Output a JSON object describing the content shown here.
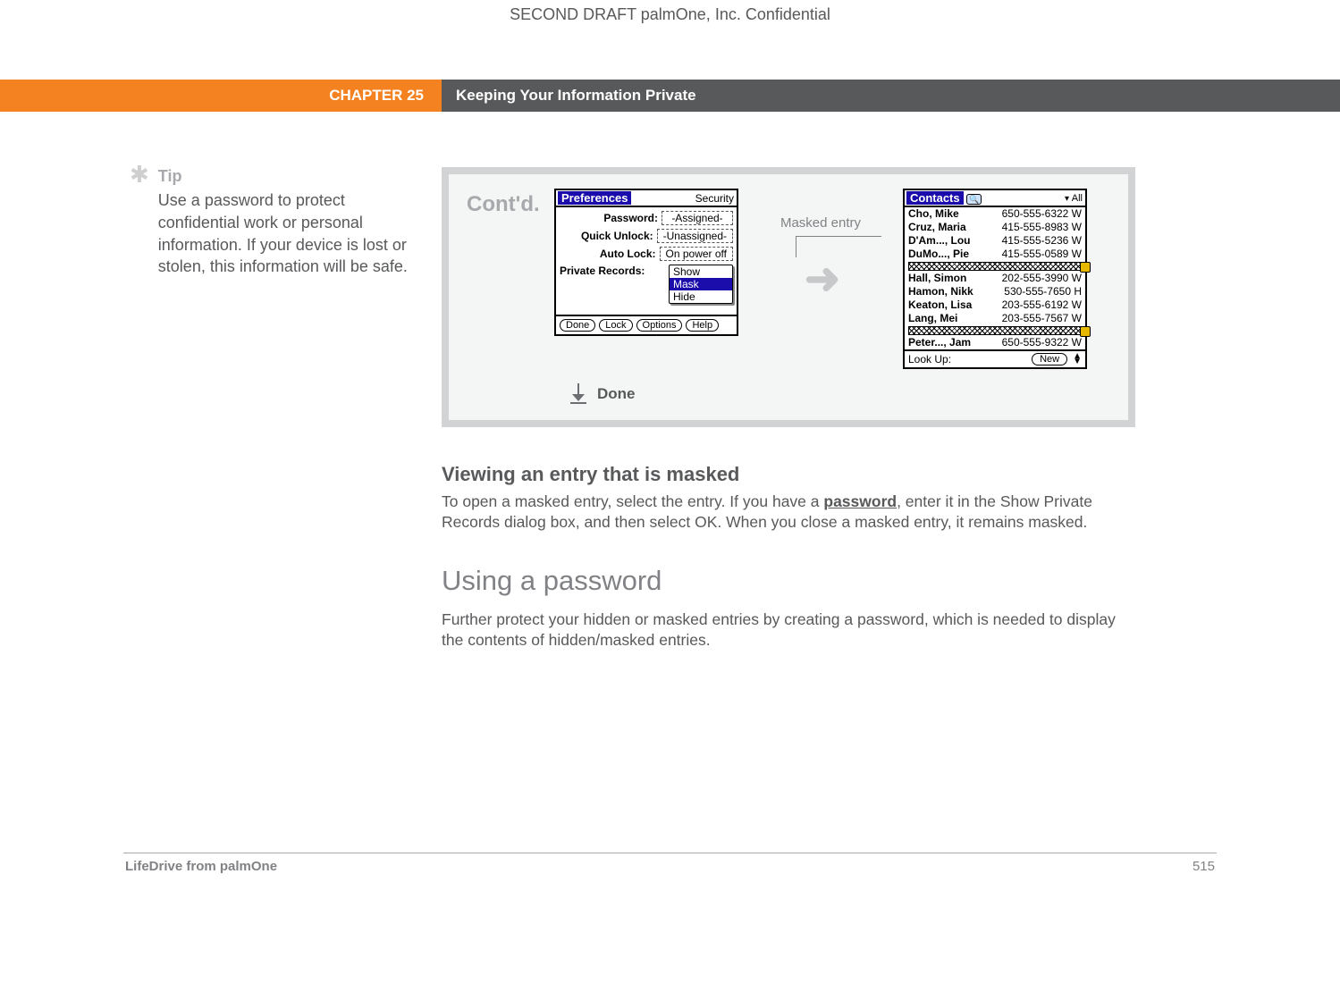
{
  "confidential": "SECOND DRAFT palmOne, Inc.  Confidential",
  "chapter_label": "CHAPTER 25",
  "chapter_title": "Keeping Your Information Private",
  "tip": {
    "label": "Tip",
    "body": "Use a password to protect confidential work or personal information. If your device is lost or stolen, this information will be safe."
  },
  "step": {
    "contd": "Cont'd.",
    "done": "Done",
    "callout": "Masked entry"
  },
  "prefs": {
    "title": "Preferences",
    "category": "Security",
    "rows": {
      "password": {
        "label": "Password:",
        "value": "-Assigned-"
      },
      "quick_unlock": {
        "label": "Quick Unlock:",
        "value": "-Unassigned-"
      },
      "auto_lock": {
        "label": "Auto Lock:",
        "value": "On power off"
      },
      "private_records": {
        "label": "Private Records:"
      }
    },
    "private_options": {
      "show": "Show",
      "mask": "Mask",
      "hide": "Hide"
    },
    "buttons": {
      "done": "Done",
      "lock": "Lock",
      "options": "Options",
      "help": "Help"
    }
  },
  "contacts": {
    "title": "Contacts",
    "category": "All",
    "entries": [
      {
        "name": "Cho, Mike",
        "num": "650-555-6322 W"
      },
      {
        "name": "Cruz, Maria",
        "num": "415-555-8983 W"
      },
      {
        "name": "D'Am..., Lou",
        "num": "415-555-5236 W"
      },
      {
        "name": "DuMo..., Pie",
        "num": "415-555-0589 W"
      }
    ],
    "entries2": [
      {
        "name": "Hall, Simon",
        "num": "202-555-3990 W"
      },
      {
        "name": "Hamon, Nikk",
        "num": "530-555-7650 H"
      },
      {
        "name": "Keaton, Lisa",
        "num": "203-555-6192 W"
      },
      {
        "name": "Lang, Mei",
        "num": "203-555-7567 W"
      }
    ],
    "entries3": [
      {
        "name": "Peter..., Jam",
        "num": "650-555-9322 W"
      }
    ],
    "lookup_label": "Look Up:",
    "new_btn": "New"
  },
  "sections": {
    "sub1": {
      "head": "Viewing an entry that is masked",
      "body_a": "To open a masked entry, select the entry. If you have a ",
      "link": "password",
      "body_b": ", enter it in the Show Private Records dialog box, and then select OK. When you close a masked entry, it remains masked."
    },
    "sub2": {
      "head": "Using a password",
      "body": "Further protect your hidden or masked entries by creating a password, which is needed to display the contents of hidden/masked entries."
    }
  },
  "footer": {
    "product": "LifeDrive from palmOne",
    "page": "515"
  }
}
